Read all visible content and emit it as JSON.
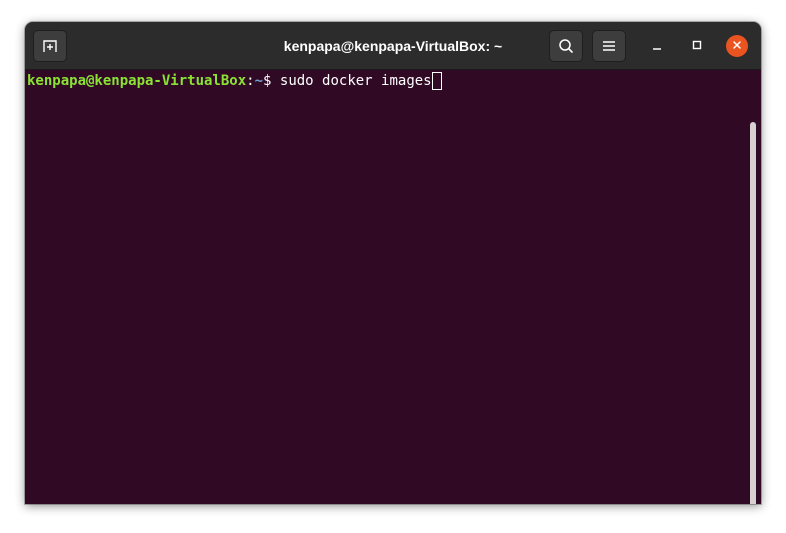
{
  "window": {
    "title": "kenpapa@kenpapa-VirtualBox: ~"
  },
  "toolbar": {
    "new_tab_icon": "new-tab-icon",
    "search_icon": "search-icon",
    "menu_icon": "hamburger-menu-icon",
    "minimize_icon": "minimize-icon",
    "maximize_icon": "maximize-icon",
    "close_icon": "close-icon"
  },
  "terminal": {
    "prompt_user": "kenpapa@kenpapa-VirtualBox",
    "prompt_colon": ":",
    "prompt_path": "~",
    "prompt_symbol": "$ ",
    "command": "sudo docker images"
  },
  "colors": {
    "terminal_bg": "#300a24",
    "titlebar_bg": "#2c2c2c",
    "prompt_user": "#8ae234",
    "prompt_path": "#729fcf",
    "close_button": "#e95420"
  }
}
